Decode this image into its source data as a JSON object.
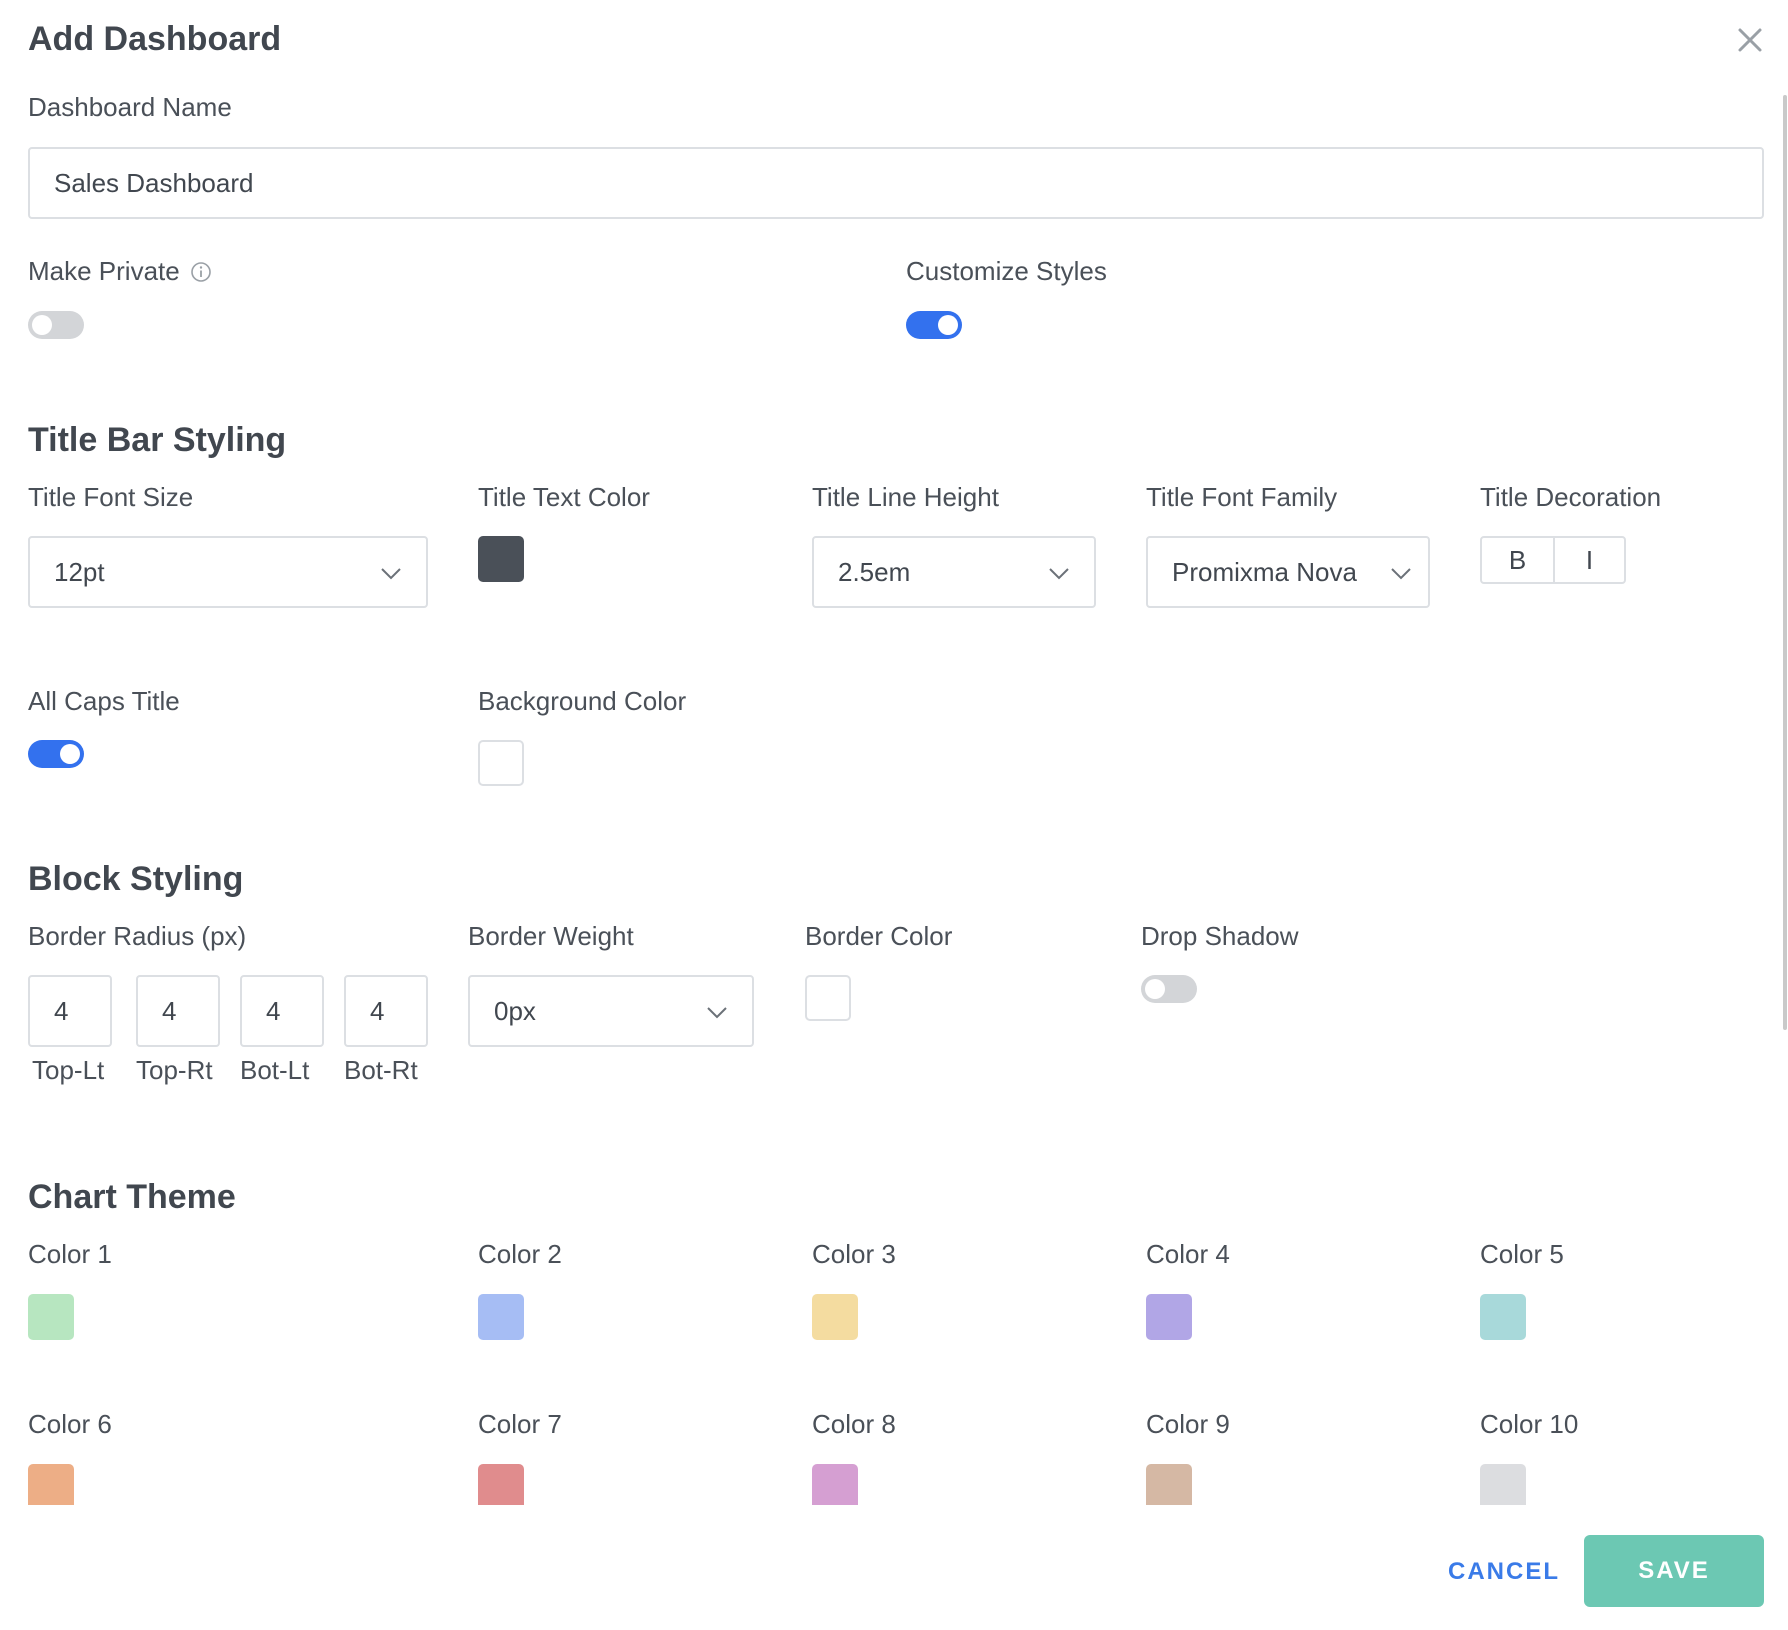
{
  "dialog": {
    "title": "Add Dashboard"
  },
  "dashboard_name": {
    "label": "Dashboard Name",
    "value": "Sales Dashboard"
  },
  "make_private": {
    "label": "Make Private",
    "enabled": false,
    "info_icon": "info-icon"
  },
  "customize_styles": {
    "label": "Customize Styles",
    "enabled": true
  },
  "title_bar": {
    "heading": "Title Bar Styling",
    "font_size": {
      "label": "Title Font Size",
      "value": "12pt"
    },
    "text_color": {
      "label": "Title Text Color",
      "color": "#4a5058"
    },
    "line_height": {
      "label": "Title Line Height",
      "value": "2.5em"
    },
    "font_family": {
      "label": "Title Font Family",
      "value": "Promixma Nova"
    },
    "decoration": {
      "label": "Title Decoration",
      "bold": "B",
      "italic": "I"
    },
    "all_caps": {
      "label": "All Caps Title",
      "enabled": true
    },
    "background_color": {
      "label": "Background Color",
      "color": "#ffffff"
    }
  },
  "block": {
    "heading": "Block Styling",
    "border_radius": {
      "label": "Border Radius (px)",
      "corners": [
        {
          "value": "4",
          "label": "Top-Lt"
        },
        {
          "value": "4",
          "label": "Top-Rt"
        },
        {
          "value": "4",
          "label": "Bot-Lt"
        },
        {
          "value": "4",
          "label": "Bot-Rt"
        }
      ]
    },
    "border_weight": {
      "label": "Border Weight",
      "value": "0px"
    },
    "border_color": {
      "label": "Border Color",
      "color": "#ffffff"
    },
    "drop_shadow": {
      "label": "Drop Shadow",
      "enabled": false
    }
  },
  "chart_theme": {
    "heading": "Chart Theme",
    "colors": [
      {
        "label": "Color 1",
        "color": "#b7e6c0"
      },
      {
        "label": "Color 2",
        "color": "#a6bdf4"
      },
      {
        "label": "Color 3",
        "color": "#f4dca0"
      },
      {
        "label": "Color 4",
        "color": "#b1a6e6"
      },
      {
        "label": "Color 5",
        "color": "#a8d9da"
      },
      {
        "label": "Color 6",
        "color": "#edae86"
      },
      {
        "label": "Color 7",
        "color": "#e08c8d"
      },
      {
        "label": "Color 8",
        "color": "#d59fd2"
      },
      {
        "label": "Color 9",
        "color": "#d5b8a4"
      },
      {
        "label": "Color 10",
        "color": "#dcdde0"
      }
    ]
  },
  "footer": {
    "cancel_label": "CANCEL",
    "save_label": "SAVE"
  },
  "accent_color": "#3371ee",
  "save_color": "#6cc8b3"
}
